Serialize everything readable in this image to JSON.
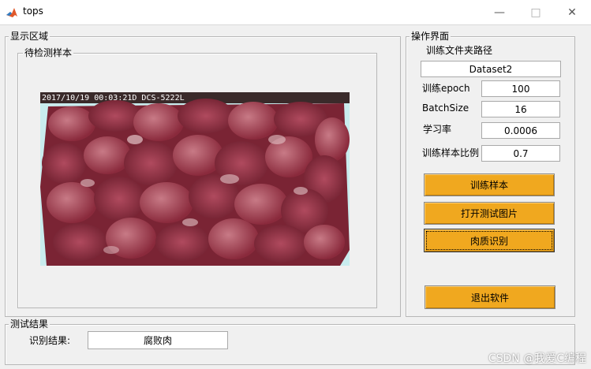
{
  "window": {
    "title": "tops",
    "minimize_glyph": "—",
    "maximize_glyph": "□",
    "close_glyph": "✕"
  },
  "display_panel": {
    "title": "显示区域",
    "sample_panel_title": "待检测样本",
    "image_timestamp": "2017/10/19 00:03:21D DCS-5222L"
  },
  "operation_panel": {
    "title": "操作界面",
    "folder_label": "训练文件夹路径",
    "folder_value": "Dataset2",
    "epoch_label": "训练epoch",
    "epoch_value": "100",
    "batchsize_label": "BatchSize",
    "batchsize_value": "16",
    "lr_label": "学习率",
    "lr_value": "0.0006",
    "ratio_label": "训练样本比例",
    "ratio_value": "0.7",
    "train_button": "训练样本",
    "open_button": "打开测试图片",
    "identify_button": "肉质识别",
    "exit_button": "退出软件"
  },
  "result_panel": {
    "title": "测试结果",
    "result_label": "识别结果:",
    "result_value": "腐败肉"
  },
  "watermark": "CSDN @我爱C编程",
  "colors": {
    "button_bg": "#f0a81f",
    "window_bg": "#f0f0f0",
    "image_bg": "#b8e6e8"
  }
}
